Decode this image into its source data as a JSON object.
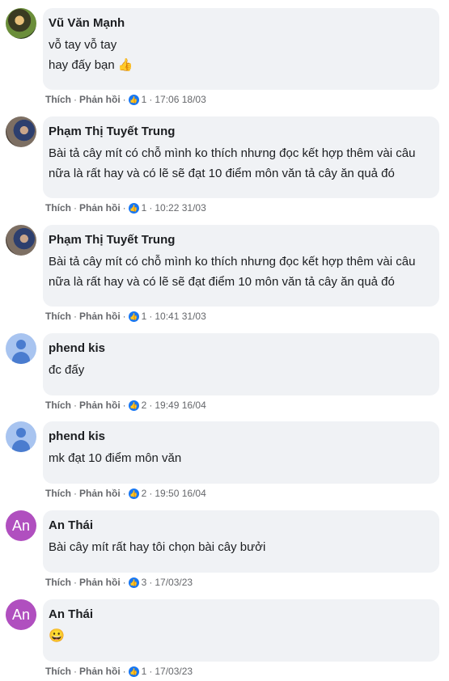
{
  "ui": {
    "like_label": "Thích",
    "reply_label": "Phản hồi",
    "dot": "·"
  },
  "comments": [
    {
      "author": "Vũ Văn Mạnh",
      "lines": [
        "vỗ tay vỗ tay",
        "hay đấy bạn 👍"
      ],
      "likes": "1",
      "time": "17:06 18/03",
      "avatar": "photo-1"
    },
    {
      "author": "Phạm Thị Tuyết Trung",
      "lines": [
        "Bài tả cây mít có chỗ mình ko thích nhưng đọc kết hợp thêm vài câu",
        "nữa là rất hay và có lẽ sẽ đạt 10 điểm môn văn tả cây ăn quả đó"
      ],
      "likes": "1",
      "time": "10:22 31/03",
      "avatar": "photo-2"
    },
    {
      "author": "Phạm Thị Tuyết Trung",
      "lines": [
        "Bài tả cây mít có chỗ mình ko thích nhưng đọc kết hợp thêm vài câu",
        "nữa là rất hay và có lẽ sẽ đạt điểm 10 môn văn tả cây ăn quả đó"
      ],
      "likes": "1",
      "time": "10:41 31/03",
      "avatar": "photo-2"
    },
    {
      "author": "phend kis",
      "lines": [
        "đc đấy"
      ],
      "likes": "2",
      "time": "19:49 16/04",
      "avatar": "default"
    },
    {
      "author": "phend kis",
      "lines": [
        "mk đạt 10 điểm môn văn"
      ],
      "likes": "2",
      "time": "19:50 16/04",
      "avatar": "default"
    },
    {
      "author": "An Thái",
      "lines": [
        "Bài cây mít rất hay tôi chọn bài cây bưởi"
      ],
      "likes": "3",
      "time": "17/03/23",
      "avatar": "letter",
      "avatar_text": "An"
    },
    {
      "author": "An Thái",
      "lines": [
        "😀"
      ],
      "likes": "1",
      "time": "17/03/23",
      "avatar": "letter",
      "avatar_text": "An"
    }
  ]
}
